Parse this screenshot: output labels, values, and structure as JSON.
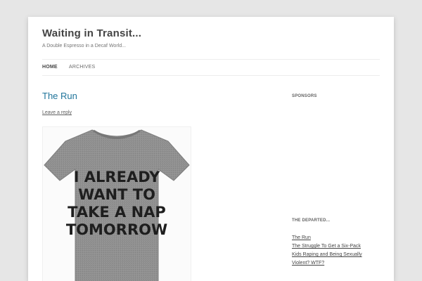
{
  "site": {
    "title": "Waiting in Transit...",
    "tagline": "A Double Espresso in a Decaf World..."
  },
  "nav": {
    "items": [
      {
        "label": "HOME",
        "active": true
      },
      {
        "label": "ARCHIVES",
        "active": false
      }
    ]
  },
  "post": {
    "title": "The Run",
    "reply_label": "Leave a reply",
    "image": {
      "depicts": "grey-tshirt",
      "shirt_lines": [
        "I ALREADY",
        "WANT TO",
        "TAKE A NAP",
        "TOMORROW"
      ]
    }
  },
  "sidebar": {
    "sponsors_title": "SPONSORS",
    "departed_title": "THE DEPARTED...",
    "departed_links": [
      "The Run",
      "The Struggle To Get a Six-Pack",
      "Kids Raping and Being Sexually",
      "Violent? WTF?"
    ]
  },
  "colors": {
    "link_blue": "#21759b",
    "background": "#e6e6e6",
    "shirt_grey": "#8f8f8f"
  }
}
